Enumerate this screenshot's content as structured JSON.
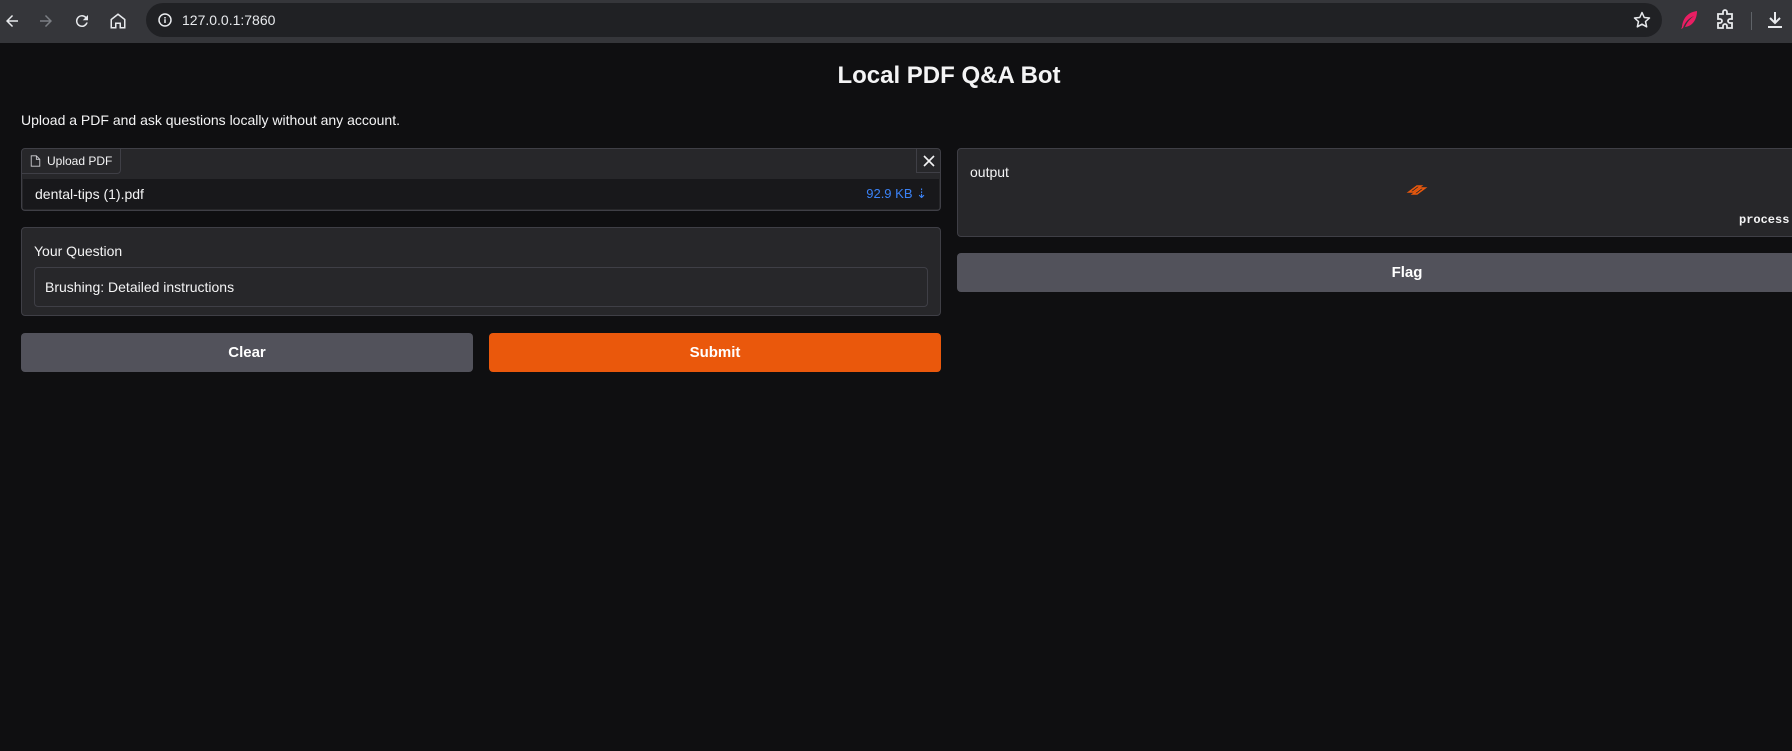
{
  "browser": {
    "url": "127.0.0.1:7860",
    "colors": {
      "chrome_bg": "#35363a",
      "omnibox_bg": "#202124",
      "ext_accent": "#e91e63"
    }
  },
  "app": {
    "title": "Local PDF Q&A Bot",
    "description": "Upload a PDF and ask questions locally without any account.",
    "file_upload": {
      "label": "Upload PDF",
      "file_name": "dental-tips (1).pdf",
      "file_size": "92.9 KB ⇣"
    },
    "question": {
      "label": "Your Question",
      "value": "Brushing: Detailed instructions"
    },
    "buttons": {
      "clear": "Clear",
      "submit": "Submit",
      "flag": "Flag"
    },
    "output": {
      "label": "output",
      "status": "process:"
    },
    "colors": {
      "background": "#0f0f11",
      "panel": "#27272a",
      "primary": "#ea580c",
      "secondary": "#52525b",
      "link": "#3b82f6"
    }
  }
}
